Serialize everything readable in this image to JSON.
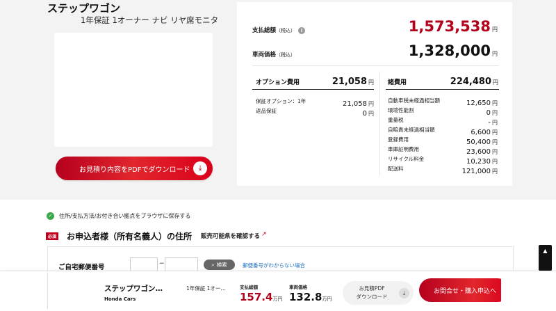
{
  "vehicle": {
    "name": "ステップワゴン",
    "grade": "1年保証 1オーナー ナビ リヤ席モニタ"
  },
  "pdf_button_label": "お見積り内容をPDFでダウンロード",
  "prices": {
    "total_label": "支払総額",
    "total_tax": "（税込）",
    "total_value": "1,573,538",
    "car_label": "車両価格",
    "car_tax": "（税込）",
    "car_value": "1,328,000",
    "yen": "円"
  },
  "options": {
    "title": "オプション費用",
    "total": "21,058",
    "items": [
      {
        "label": "保証オプション：1年",
        "value": "21,058"
      },
      {
        "label": "返品保証",
        "value": "0"
      }
    ]
  },
  "fees": {
    "title": "諸費用",
    "total": "224,480",
    "items": [
      {
        "label": "自動車税未経過相当額",
        "value": "12,650"
      },
      {
        "label": "環境性能割",
        "value": "0"
      },
      {
        "label": "重量税",
        "value": "-"
      },
      {
        "label": "自賠責未経過相当額",
        "value": "6,600"
      },
      {
        "label": "登録費用",
        "value": "50,400"
      },
      {
        "label": "車庫証明費用",
        "value": "23,600"
      },
      {
        "label": "リサイクル料金",
        "value": "10,230"
      },
      {
        "label": "配送料",
        "value": "121,000"
      }
    ]
  },
  "form": {
    "save_text": "住所/支払方法/お付き合い拠点をブラウザに保存する",
    "required_badge": "必須",
    "address_title": "お申込者様（所有名義人）の住所",
    "check_prefs_link": "販売可能県を確認する",
    "zip_label": "ご自宅郵便番号",
    "zip_dash": "−",
    "search_button": "検索",
    "zip_unknown_link": "郵便番号がわからない場合"
  },
  "bottom_bar": {
    "name": "ステップワゴン…",
    "grade": "1年保証 1オー…",
    "dealer": "Honda Cars",
    "total_label": "支払総額",
    "total_value": "157.4",
    "car_label": "車両価格",
    "car_value": "132.8",
    "unit": "万円",
    "pdf_line1": "お見積PDF",
    "pdf_line2": "ダウンロード",
    "contact_button": "お問合せ・購入申込へ"
  },
  "icons": {
    "info": "info-icon",
    "download": "download-icon",
    "check": "check-circle-icon",
    "external": "external-link-icon",
    "search": "search-icon",
    "scroll_top": "chevron-up-icon"
  },
  "colors": {
    "accent_red": "#c0001d",
    "price_red": "#b3001b",
    "link_blue": "#1a6fc2",
    "check_green": "#3aa84b"
  }
}
